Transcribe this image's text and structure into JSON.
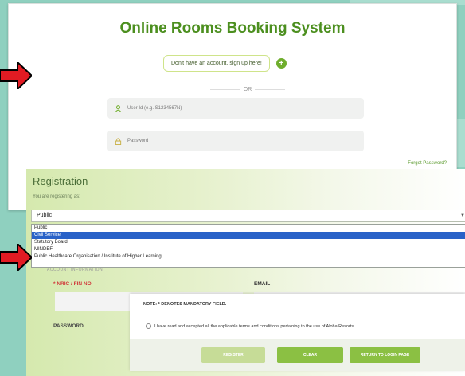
{
  "login": {
    "title": "Online Rooms Booking System",
    "signup_label": "Don't have an account, sign up here!",
    "or_label": "OR",
    "user_id_placeholder": "User Id (e.g. S1234567N)",
    "password_placeholder": "Password",
    "forgot_label": "Forgot Password?"
  },
  "registration": {
    "title": "Registration",
    "subtitle": "You are registering as:",
    "selected_value": "Public",
    "options": [
      "Public",
      "Civil Service",
      "Statutory Board",
      "MINDEF",
      "Public Healthcare Organisation / Institute of Higher Learning"
    ],
    "highlighted_option_index": 1,
    "account_section_label": "ACCOUNT INFORMATION",
    "nric_label": "* NRIC / FIN NO",
    "email_label": "EMAIL",
    "password_label": "PASSWORD"
  },
  "note": {
    "mandatory_text": "NOTE: * DENOTES MANDATORY FIELD.",
    "terms_text": "I have read and accepted all the applicable terms and conditions pertaining to the use of Aloha Resorts",
    "register_label": "REGISTER",
    "clear_label": "CLEAR",
    "return_label": "RETURN TO LOGIN PAGE"
  },
  "colors": {
    "accent_green": "#8bc043",
    "brand_green": "#4c8f1f",
    "selection_blue": "#2962c8",
    "arrow_red": "#e21b23"
  },
  "icons": [
    "user-icon",
    "lock-icon",
    "plus-icon",
    "arrow-icon",
    "caret-down-icon"
  ]
}
